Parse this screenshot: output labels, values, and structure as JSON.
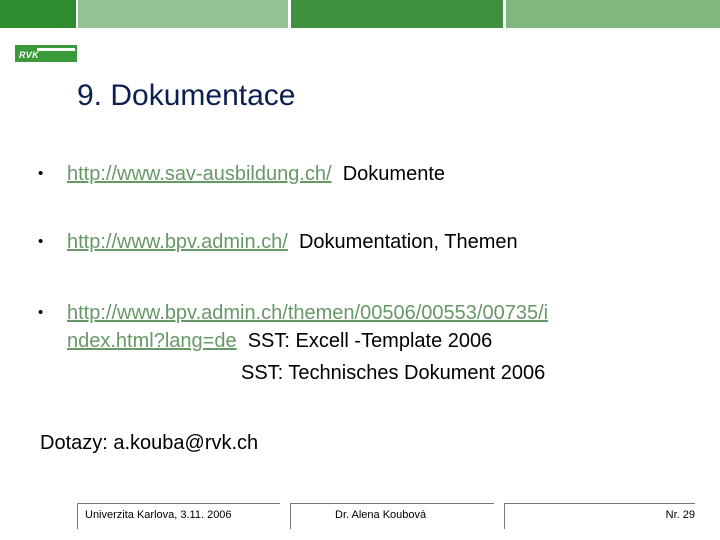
{
  "colors": {
    "bar_1": "#2e8b2e",
    "bar_2": "#93c393",
    "bar_3": "#3f913f",
    "bar_4": "#7fb77f",
    "link": "#669966",
    "title": "#0b1f52"
  },
  "logo": {
    "text": "RVK"
  },
  "title": "9. Dokumentace",
  "items": [
    {
      "link": "http://www.sav-ausbildung.ch/",
      "text": "Dokumente"
    },
    {
      "link": "http://www.bpv.admin.ch/",
      "text": "Dokumentation, Themen"
    },
    {
      "link_line1": "http://www.bpv.admin.ch/themen/00506/00553/00735/i",
      "link_line2": "ndex.html?lang=de",
      "text": "SST: Excell -Template 2006",
      "text2": "SST: Technisches Dokument 2006"
    }
  ],
  "contact": "Dotazy: a.kouba@rvk.ch",
  "footer": {
    "left": "Univerzita Karlova, 3.11. 2006",
    "center": "Dr. Alena Koubová",
    "right": "Nr. 29"
  }
}
